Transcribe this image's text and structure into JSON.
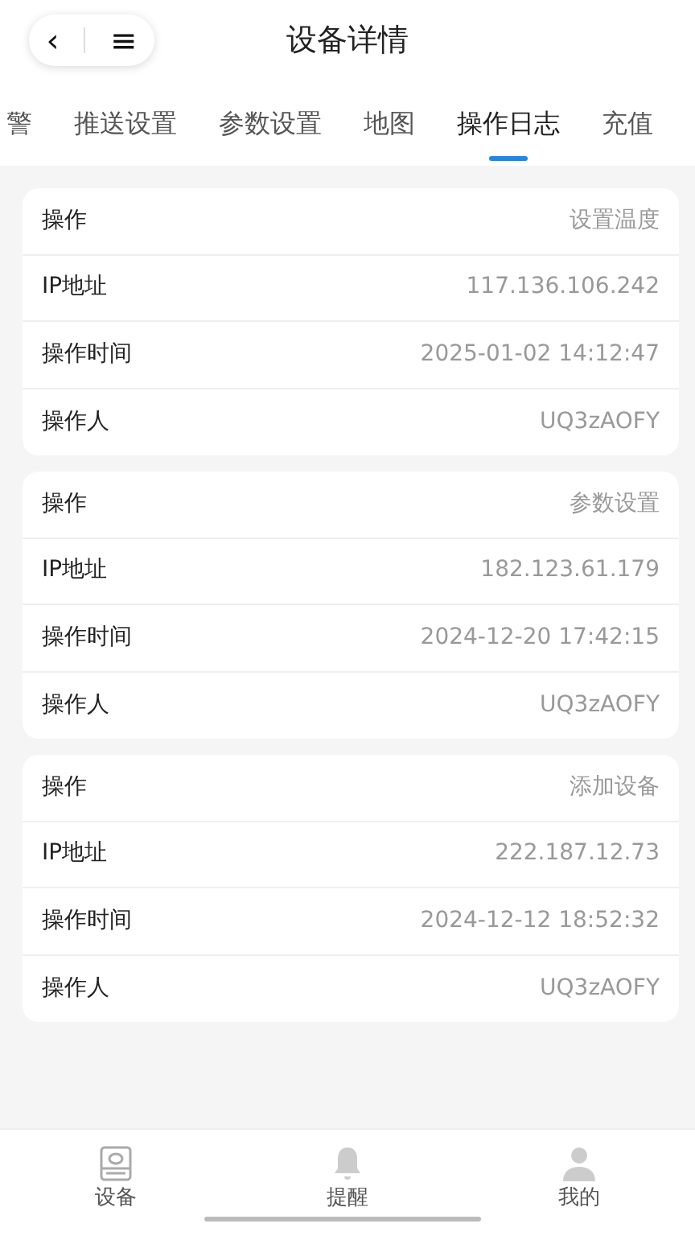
{
  "header": {
    "title": "设备详情",
    "back": "‹",
    "menu": "≡"
  },
  "tabs": [
    {
      "label": "警",
      "selected": false
    },
    {
      "label": "推送设置",
      "selected": false
    },
    {
      "label": "参数设置",
      "selected": false
    },
    {
      "label": "地图",
      "selected": false
    },
    {
      "label": "操作日志",
      "selected": true
    },
    {
      "label": "充值",
      "selected": false
    }
  ],
  "logs": [
    {
      "rows": [
        {
          "label": "操作",
          "value": "设置温度"
        },
        {
          "label": "IP地址",
          "value": "117.136.106.242"
        },
        {
          "label": "操作时间",
          "value": "2025-01-02 14:12:47"
        },
        {
          "label": "操作人",
          "value": "UQ3zAOFY"
        }
      ]
    },
    {
      "rows": [
        {
          "label": "操作",
          "value": "参数设置"
        },
        {
          "label": "IP地址",
          "value": "182.123.61.179"
        },
        {
          "label": "操作时间",
          "value": "2024-12-20 17:42:15"
        },
        {
          "label": "操作人",
          "value": "UQ3zAOFY"
        }
      ]
    },
    {
      "rows": [
        {
          "label": "操作",
          "value": "添加设备"
        },
        {
          "label": "IP地址",
          "value": "222.187.12.73"
        },
        {
          "label": "操作时间",
          "value": "2024-12-12 18:52:32"
        },
        {
          "label": "操作人",
          "value": "UQ3zAOFY"
        }
      ]
    }
  ],
  "bottom_nav": [
    {
      "label": "设备",
      "kind": "device"
    },
    {
      "label": "提醒",
      "kind": "bell"
    },
    {
      "label": "我的",
      "kind": "person"
    }
  ]
}
